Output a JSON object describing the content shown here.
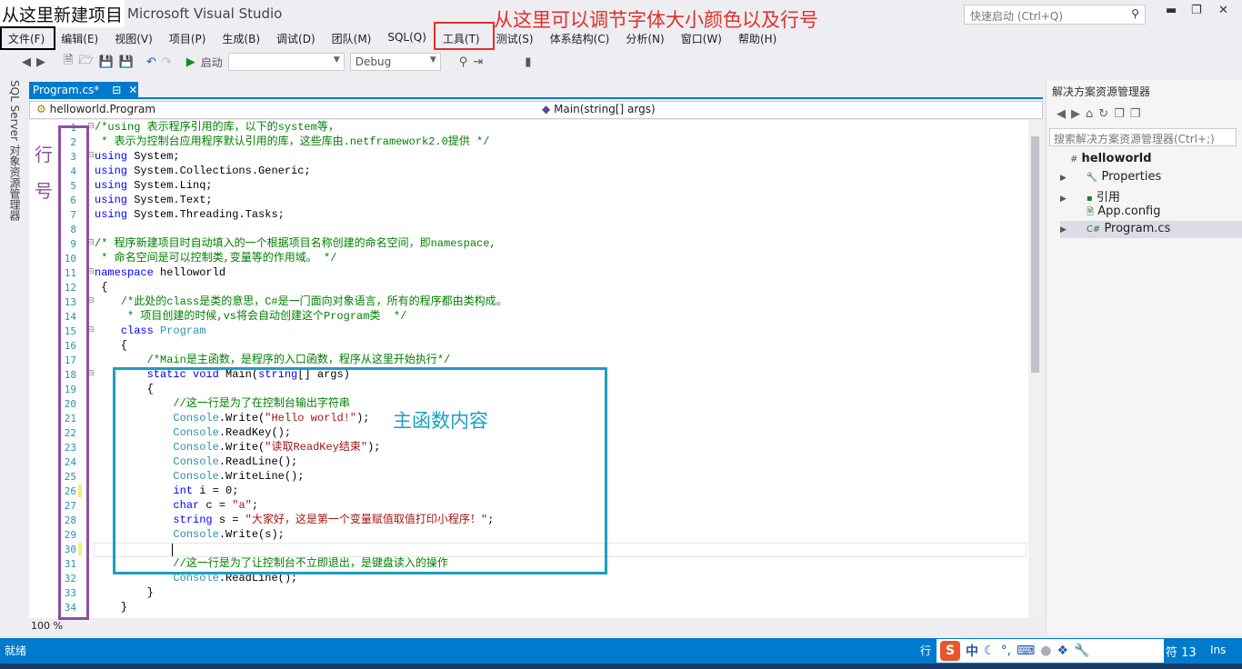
{
  "window": {
    "title": "Microsoft Visual Studio",
    "quick_launch_placeholder": "快速启动 (Ctrl+Q)"
  },
  "menu": [
    "文件(F)",
    "编辑(E)",
    "视图(V)",
    "项目(P)",
    "生成(B)",
    "调试(D)",
    "团队(M)",
    "SQL(Q)",
    "工具(T)",
    "测试(S)",
    "体系结构(C)",
    "分析(N)",
    "窗口(W)",
    "帮助(H)"
  ],
  "toolbar": {
    "start_label": "启动",
    "config": "Debug",
    "platform": ""
  },
  "left_strip": "SQL Server 对象资源管理器",
  "editor": {
    "tab": "Program.cs*",
    "nav_left": "helloworld.Program",
    "nav_right": "Main(string[] args)",
    "zoom": "100 %",
    "lines": [
      [
        [
          "c",
          "/*using 表示程序引用的库，以下的system等，"
        ]
      ],
      [
        [
          "c",
          " * 表示为控制台应用程序默认引用的库，这些库由.netframework2.0提供 */"
        ]
      ],
      [
        [
          "k",
          "using"
        ],
        [
          "p",
          " System;"
        ]
      ],
      [
        [
          "k",
          "using"
        ],
        [
          "p",
          " System.Collections.Generic;"
        ]
      ],
      [
        [
          "k",
          "using"
        ],
        [
          "p",
          " System.Linq;"
        ]
      ],
      [
        [
          "k",
          "using"
        ],
        [
          "p",
          " System.Text;"
        ]
      ],
      [
        [
          "k",
          "using"
        ],
        [
          "p",
          " System.Threading.Tasks;"
        ]
      ],
      [],
      [
        [
          "c",
          "/* 程序新建项目时自动填入的一个根据项目名称创建的命名空间，即namespace,"
        ]
      ],
      [
        [
          "c",
          " * 命名空间是可以控制类,变量等的作用域。 */"
        ]
      ],
      [
        [
          "k",
          "namespace"
        ],
        [
          "p",
          " helloworld"
        ]
      ],
      [
        [
          "p",
          " {"
        ]
      ],
      [
        [
          "c",
          "    /*此处的class是类的意思，C#是一门面向对象语言，所有的程序都由类构成。"
        ]
      ],
      [
        [
          "c",
          "     * 项目创建的时候,vs将会自动创建这个Program类  */"
        ]
      ],
      [
        [
          "p",
          "    "
        ],
        [
          "k",
          "class"
        ],
        [
          "p",
          " "
        ],
        [
          "t",
          "Program"
        ]
      ],
      [
        [
          "p",
          "    {"
        ]
      ],
      [
        [
          "c",
          "        /*Main是主函数，是程序的入口函数，程序从这里开始执行*/"
        ]
      ],
      [
        [
          "p",
          "        "
        ],
        [
          "k",
          "static void"
        ],
        [
          "p",
          " Main("
        ],
        [
          "k",
          "string"
        ],
        [
          "p",
          "[] args)"
        ]
      ],
      [
        [
          "p",
          "        {"
        ]
      ],
      [
        [
          "c",
          "            //这一行是为了在控制台输出字符串"
        ]
      ],
      [
        [
          "p",
          "            "
        ],
        [
          "t",
          "Console"
        ],
        [
          "p",
          ".Write("
        ],
        [
          "s",
          "\"Hello world!\""
        ],
        [
          "p",
          ");"
        ]
      ],
      [
        [
          "p",
          "            "
        ],
        [
          "t",
          "Console"
        ],
        [
          "p",
          ".ReadKey();"
        ]
      ],
      [
        [
          "p",
          "            "
        ],
        [
          "t",
          "Console"
        ],
        [
          "p",
          ".Write("
        ],
        [
          "s",
          "\"读取ReadKey结束\""
        ],
        [
          "p",
          ");"
        ]
      ],
      [
        [
          "p",
          "            "
        ],
        [
          "t",
          "Console"
        ],
        [
          "p",
          ".ReadLine();"
        ]
      ],
      [
        [
          "p",
          "            "
        ],
        [
          "t",
          "Console"
        ],
        [
          "p",
          ".WriteLine();"
        ]
      ],
      [
        [
          "p",
          "            "
        ],
        [
          "k",
          "int"
        ],
        [
          "p",
          " i = 0;"
        ]
      ],
      [
        [
          "p",
          "            "
        ],
        [
          "k",
          "char"
        ],
        [
          "p",
          " c = "
        ],
        [
          "s",
          "\"a\""
        ],
        [
          "p",
          ";"
        ]
      ],
      [
        [
          "p",
          "            "
        ],
        [
          "k",
          "string"
        ],
        [
          "p",
          " s = "
        ],
        [
          "s",
          "\"大家好，这是第一个变量赋值取值打印小程序！\""
        ],
        [
          "p",
          ";"
        ]
      ],
      [
        [
          "p",
          "            "
        ],
        [
          "t",
          "Console"
        ],
        [
          "p",
          ".Write(s);"
        ]
      ],
      [],
      [
        [
          "c",
          "            //这一行是为了让控制台不立即退出，是键盘读入的操作"
        ]
      ],
      [
        [
          "p",
          "            "
        ],
        [
          "t",
          "Console"
        ],
        [
          "p",
          ".ReadLine();"
        ]
      ],
      [
        [
          "p",
          "        }"
        ]
      ],
      [
        [
          "p",
          "    }"
        ]
      ]
    ]
  },
  "solution_explorer": {
    "title": "解决方案资源管理器",
    "search_placeholder": "搜索解决方案资源管理器(Ctrl+;)",
    "items": [
      {
        "label": "helloworld",
        "icon": "csharp-project-icon"
      },
      {
        "label": "Properties",
        "icon": "wrench-icon"
      },
      {
        "label": "引用",
        "icon": "references-icon"
      },
      {
        "label": "App.config",
        "icon": "config-file-icon"
      },
      {
        "label": "Program.cs",
        "icon": "csharp-file-icon"
      }
    ]
  },
  "status": {
    "text": "就绪",
    "line_label": "行",
    "char_label": "符 13",
    "ins": "Ins",
    "ime_chinese": "中"
  },
  "annotations": {
    "new_project": "从这里新建项目",
    "tools_note": "从这里可以调节字体大小颜色以及行号",
    "line_number_note": "行\n号",
    "main_body_note": "主函数内容"
  },
  "colors": {
    "accent": "#007acc",
    "keyword": "#0000ff",
    "comment": "#008000",
    "type": "#2b91af",
    "string": "#a31515",
    "note_red": "#e0302a",
    "note_purple": "#8e4fa0",
    "note_cyan": "#1a9fc4"
  }
}
